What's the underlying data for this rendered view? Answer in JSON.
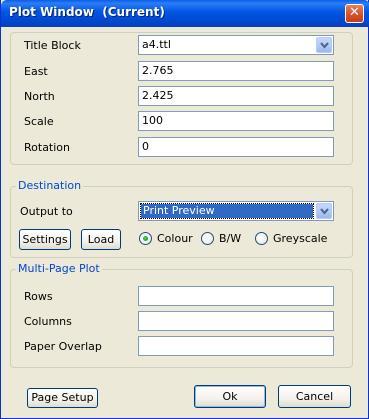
{
  "window": {
    "title": "Plot Window  (Current)",
    "close_glyph": "✕"
  },
  "plot_settings": {
    "title_block": {
      "label": "Title Block",
      "value": "a4.ttl"
    },
    "east": {
      "label": "East",
      "value": "2.765"
    },
    "north": {
      "label": "North",
      "value": "2.425"
    },
    "scale": {
      "label": "Scale",
      "value": "100"
    },
    "rotation": {
      "label": "Rotation",
      "value": "0"
    }
  },
  "destination": {
    "legend": "Destination",
    "output_to": {
      "label": "Output to",
      "value": "Print Preview"
    },
    "settings_label": "Settings",
    "load_label": "Load",
    "color_modes": [
      {
        "label": "Colour",
        "selected": true
      },
      {
        "label": "B/W",
        "selected": false
      },
      {
        "label": "Greyscale",
        "selected": false
      }
    ]
  },
  "multi_page": {
    "legend": "Multi-Page Plot",
    "rows": {
      "label": "Rows",
      "value": ""
    },
    "columns": {
      "label": "Columns",
      "value": ""
    },
    "paper_overlap": {
      "label": "Paper Overlap",
      "value": ""
    }
  },
  "footer": {
    "page_setup_label": "Page Setup",
    "ok_label": "Ok",
    "cancel_label": "Cancel"
  },
  "colors": {
    "titlebar": "#0054e3",
    "dialog_background": "#ece9d8",
    "group_legend": "#0046d5",
    "selection": "#316ac5",
    "button_border": "#003c74",
    "radio_dot": "#21a121"
  }
}
